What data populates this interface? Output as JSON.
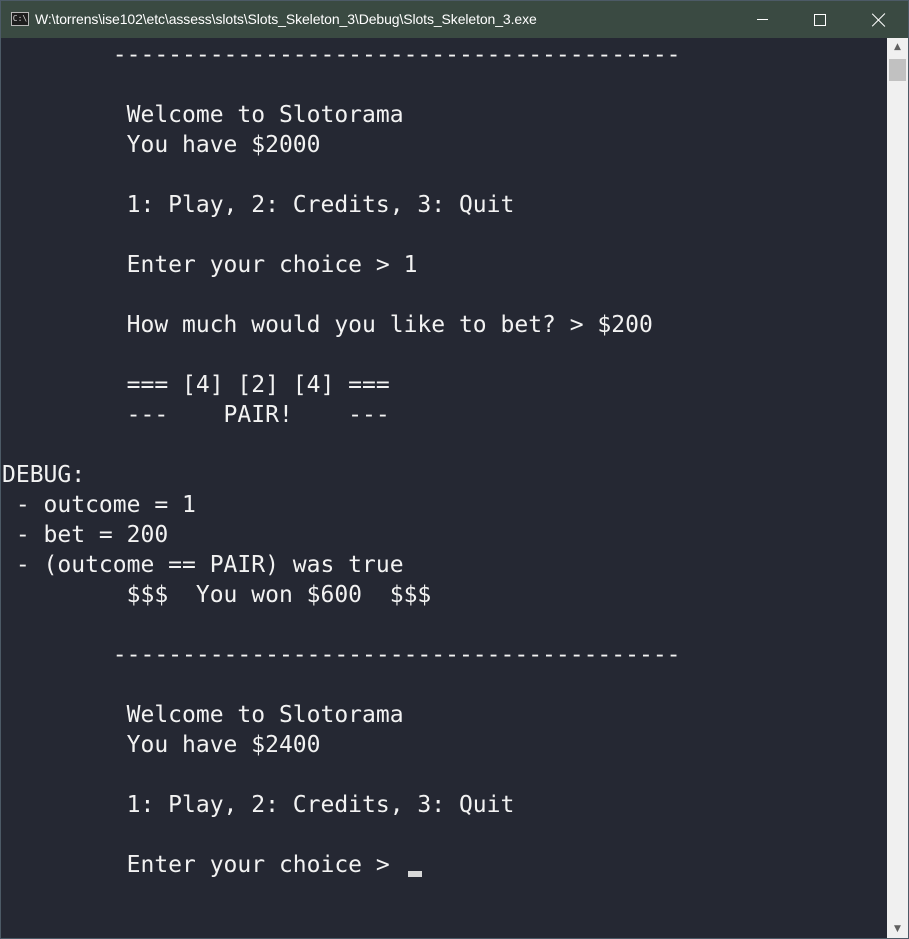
{
  "window": {
    "title": "W:\\torrens\\ise102\\etc\\assess\\slots\\Slots_Skeleton_3\\Debug\\Slots_Skeleton_3.exe",
    "icon_text": "C:\\",
    "icon": "console-app-icon",
    "controls": {
      "minimize_icon": "minimize-icon",
      "maximize_icon": "maximize-icon",
      "close_icon": "close-icon"
    }
  },
  "console": {
    "lines": [
      "        -----------------------------------------",
      "",
      "         Welcome to Slotorama",
      "         You have $2000",
      "",
      "         1: Play, 2: Credits, 3: Quit",
      "",
      "         Enter your choice > 1",
      "",
      "         How much would you like to bet? > $200",
      "",
      "         === [4] [2] [4] ===",
      "         ---    PAIR!    ---",
      "",
      "DEBUG:",
      " - outcome = 1",
      " - bet = 200",
      " - (outcome == PAIR) was true",
      "         $$$  You won $600  $$$",
      "",
      "        -----------------------------------------",
      "",
      "         Welcome to Slotorama",
      "         You have $2400",
      "",
      "         1: Play, 2: Credits, 3: Quit",
      "",
      "         Enter your choice > "
    ]
  },
  "scrollbar": {
    "up_icon": "scroll-up-arrow-icon",
    "down_icon": "scroll-down-arrow-icon"
  },
  "colors": {
    "console_background": "#252833",
    "console_text": "#f2f2f2",
    "titlebar_background": "#3a4a42"
  }
}
